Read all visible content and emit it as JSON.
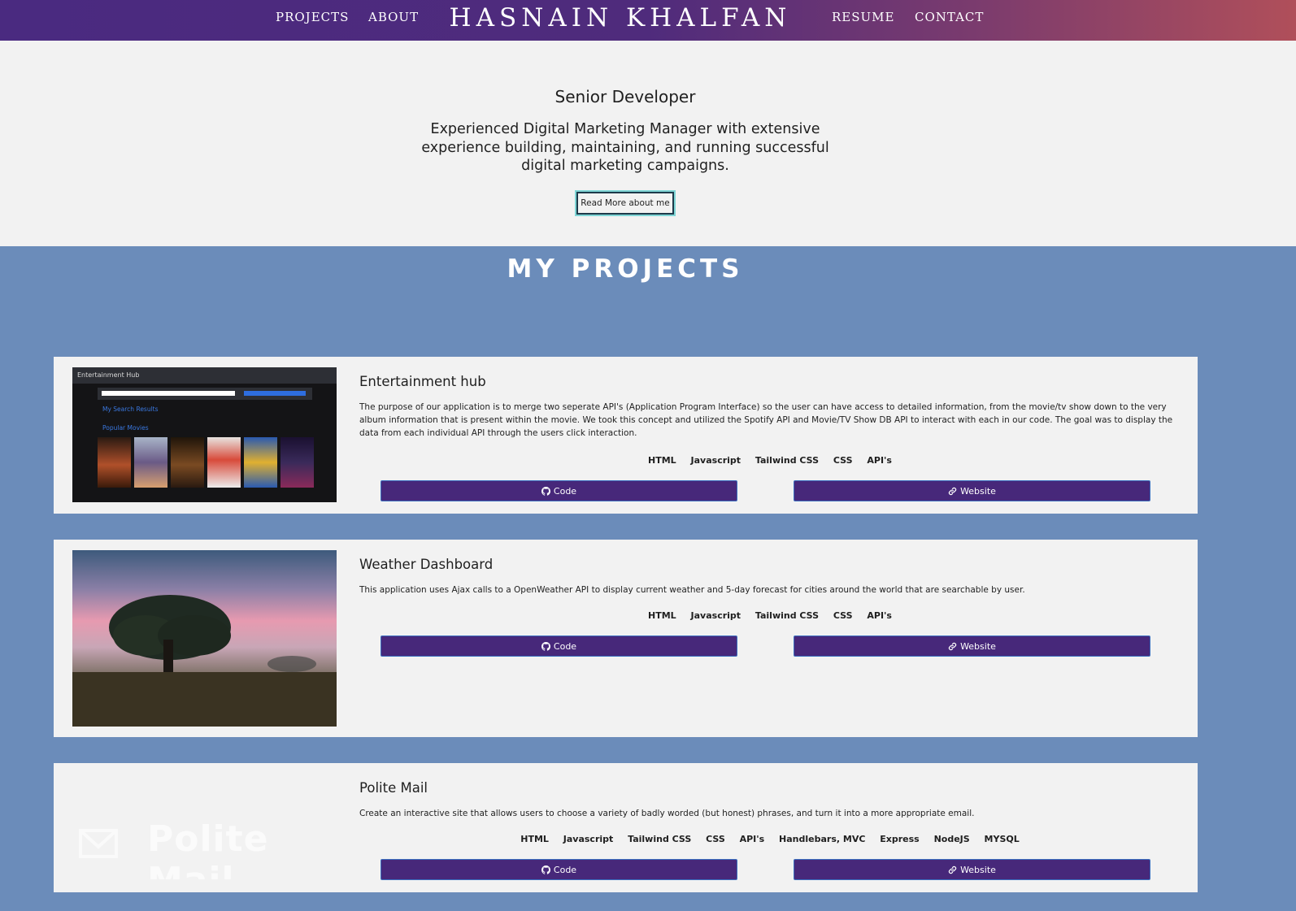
{
  "nav": {
    "brand": "HASNAIN KHALFAN",
    "links": [
      "PROJECTS",
      "ABOUT",
      "RESUME",
      "CONTACT"
    ]
  },
  "hero": {
    "title": "Senior Developer",
    "text": "Experienced Digital Marketing Manager with extensive experience building, maintaining, and running successful digital marketing campaigns.",
    "button": "Read More about me"
  },
  "projects": {
    "heading": "MY PROJECTS",
    "items": [
      {
        "title": "Entertainment hub",
        "description": "The purpose of our application is to merge two seperate API's (Application Program Interface) so the user can have access to detailed information, from the movie/tv show down to the very album information that is present within the movie. We took this concept and utilized the Spotify API and Movie/TV Show DB API to interact with each in our code. The goal was to display the data from each individual API through the users click interaction.",
        "tags": [
          "HTML",
          "Javascript",
          "Tailwind CSS",
          "CSS",
          "API's"
        ],
        "code_label": "Code",
        "website_label": "Website",
        "thumbnail": {
          "app_title": "Entertainment Hub",
          "label_1": "My Search Results",
          "label_2": "Popular Movies",
          "poster_colors": [
            "#b0502a",
            "#6a5a86",
            "#7a4a22",
            "#d84a3a",
            "#2a5ab0",
            "#3a2a5a"
          ]
        }
      },
      {
        "title": "Weather Dashboard",
        "description": "This application uses Ajax calls to a OpenWeather API to display current weather and 5-day forecast for cities around the world that are searchable by user.",
        "tags": [
          "HTML",
          "Javascript",
          "Tailwind CSS",
          "CSS",
          "API's"
        ],
        "code_label": "Code",
        "website_label": "Website"
      },
      {
        "title": "Polite Mail",
        "description": "Create an interactive site that allows users to choose a variety of badly worded (but honest) phrases, and turn it into a more appropriate email.",
        "tags": [
          "HTML",
          "Javascript",
          "Tailwind CSS",
          "CSS",
          "API's",
          "Handlebars, MVC",
          "Express",
          "NodeJS",
          "MYSQL"
        ],
        "code_label": "Code",
        "website_label": "Website",
        "thumbnail": {
          "logo_text": "Polite Mail"
        }
      }
    ]
  },
  "colors": {
    "button_bg": "#47287a",
    "page_bg": "#6b8cba",
    "hero_bg": "#f2f2f2",
    "header_gradient_start": "#4a2a80",
    "header_gradient_end": "#b04f5a"
  },
  "icons": {
    "code_button": "github-icon",
    "website_button": "link-icon",
    "polite_mail_logo": "envelope-icon"
  }
}
